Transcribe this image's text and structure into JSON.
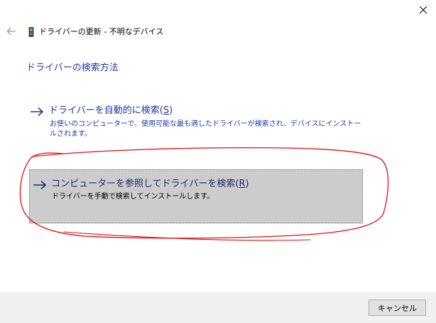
{
  "window": {
    "title": "ドライバーの更新 - 不明なデバイス",
    "back_icon": "back-arrow-icon",
    "close_icon": "close-icon",
    "device_icon": "device-icon"
  },
  "heading": "ドライバーの検索方法",
  "options": [
    {
      "title": "ドライバーを自動的に検索",
      "accelerator": "S",
      "description": "お使いのコンピューターで、使用可能な最も適したドライバーが検索され、デバイスにインストールされます。",
      "icon": "arrow-right-icon",
      "selected": false
    },
    {
      "title": "コンピューターを参照してドライバーを検索",
      "accelerator": "R",
      "description": "ドライバーを手動で検索してインストールします。",
      "icon": "arrow-right-icon",
      "selected": true
    }
  ],
  "annotation": {
    "type": "red-freehand-circle",
    "color": "#e01010",
    "target": "options.1"
  },
  "footer": {
    "cancel_label": "キャンセル"
  },
  "colors": {
    "link": "#1c3a9e",
    "selected_background": "#cccccc",
    "footer_background": "#f0f0f0"
  }
}
